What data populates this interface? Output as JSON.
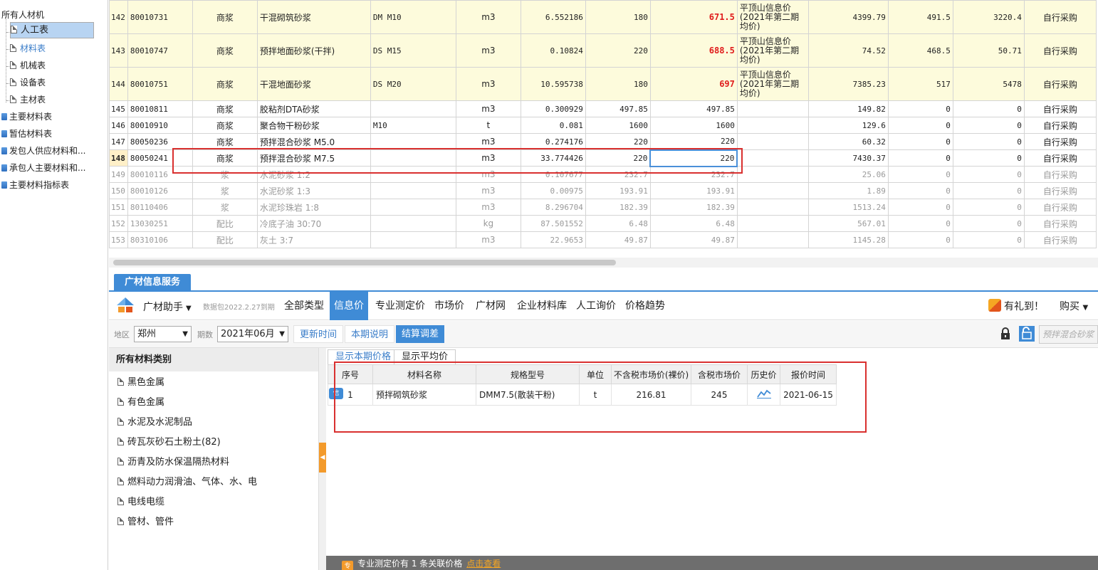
{
  "tree": {
    "root": "所有人材机",
    "children": [
      "人工表",
      "材料表",
      "机械表",
      "设备表",
      "主材表"
    ],
    "groups": [
      "主要材料表",
      "暂估材料表",
      "发包人供应材料和...",
      "承包人主要材料和...",
      "主要材料指标表"
    ]
  },
  "grid": {
    "rows": [
      {
        "no": "142",
        "code": "80010731",
        "type": "商浆",
        "name": "干混砌筑砂浆",
        "spec": "DM M10",
        "unit": "m3",
        "qty": "6.552186",
        "p1": "180",
        "p2": "671.5",
        "src": "平顶山信息价(2021年第二期均价)",
        "a": "4399.79",
        "b": "491.5",
        "c": "3220.4",
        "d": "自行采购"
      },
      {
        "no": "143",
        "code": "80010747",
        "type": "商浆",
        "name": "预拌地面砂浆(干拌)",
        "spec": "DS M15",
        "unit": "m3",
        "qty": "0.10824",
        "p1": "220",
        "p2": "688.5",
        "src": "平顶山信息价(2021年第二期均价)",
        "a": "74.52",
        "b": "468.5",
        "c": "50.71",
        "d": "自行采购"
      },
      {
        "no": "144",
        "code": "80010751",
        "type": "商浆",
        "name": "干混地面砂浆",
        "spec": "DS M20",
        "unit": "m3",
        "qty": "10.595738",
        "p1": "180",
        "p2": "697",
        "src": "平顶山信息价(2021年第二期均价)",
        "a": "7385.23",
        "b": "517",
        "c": "5478",
        "d": "自行采购"
      },
      {
        "no": "145",
        "code": "80010811",
        "type": "商浆",
        "name": "胶粘剂DTA砂浆",
        "spec": "",
        "unit": "m3",
        "qty": "0.300929",
        "p1": "497.85",
        "p2": "497.85",
        "src": "",
        "a": "149.82",
        "b": "0",
        "c": "0",
        "d": "自行采购"
      },
      {
        "no": "146",
        "code": "80010910",
        "type": "商浆",
        "name": "聚合物干粉砂浆",
        "spec": "M10",
        "unit": "t",
        "qty": "0.081",
        "p1": "1600",
        "p2": "1600",
        "src": "",
        "a": "129.6",
        "b": "0",
        "c": "0",
        "d": "自行采购"
      },
      {
        "no": "147",
        "code": "80050236",
        "type": "商浆",
        "name": "预拌混合砂浆 M5.0",
        "spec": "",
        "unit": "m3",
        "qty": "0.274176",
        "p1": "220",
        "p2": "220",
        "src": "",
        "a": "60.32",
        "b": "0",
        "c": "0",
        "d": "自行采购"
      },
      {
        "no": "148",
        "code": "80050241",
        "type": "商浆",
        "name": "预拌混合砂浆 M7.5",
        "spec": "",
        "unit": "m3",
        "qty": "33.774426",
        "p1": "220",
        "p2": "220",
        "src": "",
        "a": "7430.37",
        "b": "0",
        "c": "0",
        "d": "自行采购"
      },
      {
        "no": "149",
        "code": "80010116",
        "type": "浆",
        "name": "水泥砂浆 1:2",
        "spec": "",
        "unit": "m3",
        "qty": "0.107677",
        "p1": "232.7",
        "p2": "232.7",
        "src": "",
        "a": "25.06",
        "b": "0",
        "c": "0",
        "d": "自行采购"
      },
      {
        "no": "150",
        "code": "80010126",
        "type": "浆",
        "name": "水泥砂浆 1:3",
        "spec": "",
        "unit": "m3",
        "qty": "0.00975",
        "p1": "193.91",
        "p2": "193.91",
        "src": "",
        "a": "1.89",
        "b": "0",
        "c": "0",
        "d": "自行采购"
      },
      {
        "no": "151",
        "code": "80110406",
        "type": "浆",
        "name": "水泥珍珠岩 1:8",
        "spec": "",
        "unit": "m3",
        "qty": "8.296704",
        "p1": "182.39",
        "p2": "182.39",
        "src": "",
        "a": "1513.24",
        "b": "0",
        "c": "0",
        "d": "自行采购"
      },
      {
        "no": "152",
        "code": "13030251",
        "type": "配比",
        "name": "冷底子油 30:70",
        "spec": "",
        "unit": "kg",
        "qty": "87.501552",
        "p1": "6.48",
        "p2": "6.48",
        "src": "",
        "a": "567.01",
        "b": "0",
        "c": "0",
        "d": "自行采购"
      },
      {
        "no": "153",
        "code": "80310106",
        "type": "配比",
        "name": "灰土 3:7",
        "spec": "",
        "unit": "m3",
        "qty": "22.9653",
        "p1": "49.87",
        "p2": "49.87",
        "src": "",
        "a": "1145.28",
        "b": "0",
        "c": "0",
        "d": "自行采购"
      }
    ]
  },
  "panel": {
    "tab_title": "广材信息服务",
    "assistant": "广材助手",
    "package": "数据包2022.2.27到期",
    "nav": [
      "全部类型",
      "信息价",
      "专业测定价",
      "市场价",
      "广材网",
      "企业材料库",
      "人工询价",
      "价格趋势"
    ],
    "gift": "有礼到！",
    "buy": "购买",
    "filter": {
      "region_label": "地区",
      "region": "郑州",
      "period_label": "期数",
      "period": "2021年06月",
      "btn_update": "更新时间",
      "btn_desc": "本期说明",
      "btn_settle": "结算调差",
      "search": "预拌混合砂浆"
    },
    "categories": {
      "header": "所有材料类别",
      "items": [
        "黑色金属",
        "有色金属",
        "水泥及水泥制品",
        "砖瓦灰砂石土粉土(82)",
        "沥青及防水保温隔热材料",
        "燃料动力润滑油、气体、水、电",
        "电线电缆",
        "管材、管件"
      ]
    },
    "subtabs": [
      "显示本期价格",
      "显示平均价"
    ],
    "result_headers": [
      "序号",
      "材料名称",
      "规格型号",
      "单位",
      "不含税市场价(裸价)",
      "含税市场价",
      "历史价",
      "报价时间"
    ],
    "result_row": {
      "no": "1",
      "name": "预拌砌筑砂浆",
      "spec": "DMM7.5(散装干粉)",
      "unit": "t",
      "net": "216.81",
      "gross": "245",
      "date": "2021-06-15"
    },
    "status": "专业测定价有 1 条关联价格",
    "status_link": "点击查看"
  },
  "colors": {
    "accent": "#3f8bd6",
    "highlight_red": "#e01b1b",
    "box_red": "#d9302f",
    "orange": "#f39a2b"
  }
}
